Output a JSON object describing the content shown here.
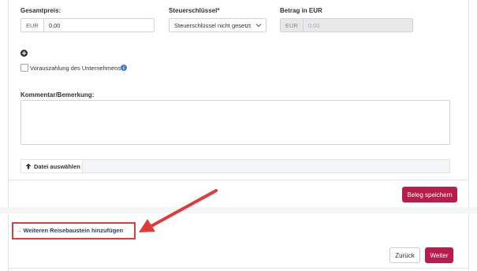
{
  "total": {
    "label": "Gesamtpreis:",
    "currency": "EUR",
    "value": "0,00"
  },
  "tax": {
    "label": "Steuerschlüssel*",
    "selected": "Steuerschlüssel nicht gesetzt"
  },
  "amount_eur": {
    "label": "Betrag in EUR",
    "currency": "EUR",
    "value": "0,00"
  },
  "prepayment": {
    "label": "Vorauszahlung des Unternehmens"
  },
  "comment": {
    "label": "Kommentar/Bemerkung:",
    "value": ""
  },
  "file": {
    "button_label": "Datei auswählen"
  },
  "save_button": "Beleg speichern",
  "add_segment": {
    "arrow": "→",
    "label": "Weiteren Reisebaustein hinzufügen"
  },
  "nav": {
    "back": "Zurück",
    "next": "Weiter"
  },
  "colors": {
    "accent": "#b71c4b",
    "highlight": "#e03a3a",
    "info": "#3a7bd5"
  }
}
